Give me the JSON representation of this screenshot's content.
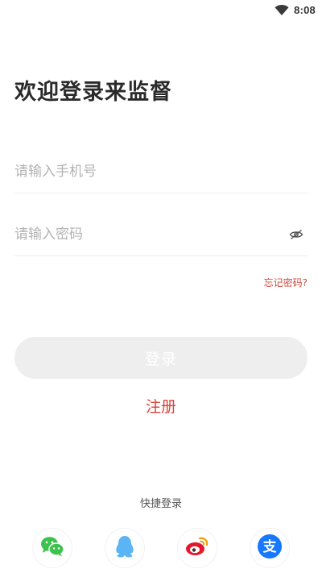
{
  "status": {
    "time": "8:08"
  },
  "title": "欢迎登录来监督",
  "phone_input": {
    "placeholder": "请输入手机号",
    "value": ""
  },
  "password_input": {
    "placeholder": "请输入密码",
    "value": ""
  },
  "forgot_password": "忘记密码?",
  "login_button": "登录",
  "register_link": "注册",
  "quick_login_title": "快捷登录",
  "social": [
    {
      "name": "wechat",
      "icon": "wechat-icon",
      "color": "#3dc24d"
    },
    {
      "name": "qq",
      "icon": "qq-icon",
      "color": "#5bb4f4"
    },
    {
      "name": "weibo",
      "icon": "weibo-icon",
      "color": "#e6162d"
    },
    {
      "name": "alipay",
      "icon": "alipay-icon",
      "color": "#1677ff"
    }
  ],
  "colors": {
    "accent_red": "#d9453b",
    "button_disabled": "#eeeeee",
    "divider": "#eeeeee"
  }
}
